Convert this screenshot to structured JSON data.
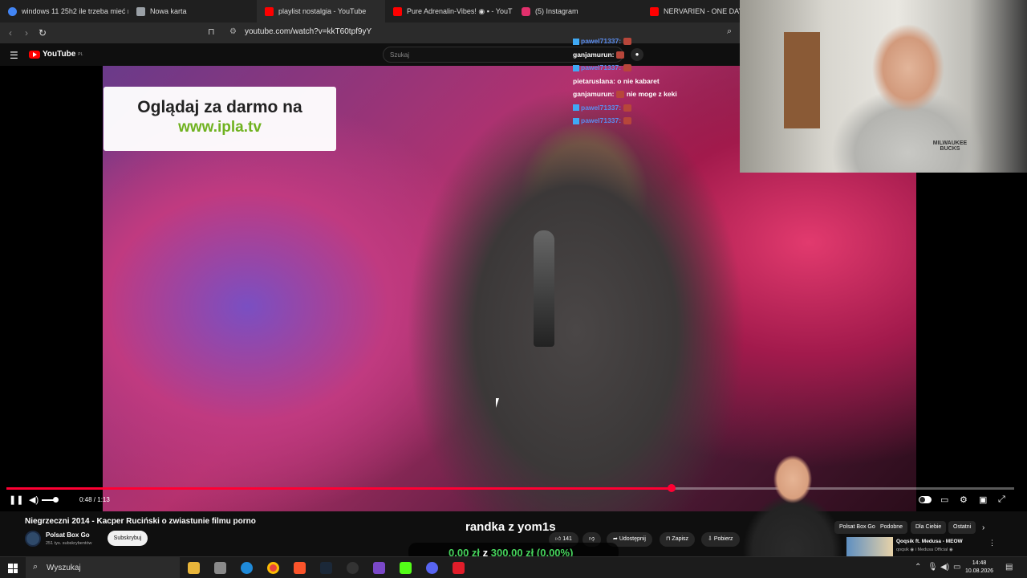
{
  "browser": {
    "tabs": [
      {
        "label": "windows 11 25h2 ile trzeba mieć m",
        "color": "#4285f4"
      },
      {
        "label": "Nowa karta",
        "color": "#9aa0a6"
      },
      {
        "label": "playlist nostalgia - YouTube",
        "color": "#ff0000"
      },
      {
        "label": "Pure Adrenalin-Vibes! ◉ ▪ - YouT",
        "color": "#ff0000"
      },
      {
        "label": "(5) Instagram",
        "color": "#e1306c"
      },
      {
        "label": "NERVARIEN - ONE DAY 12",
        "color": "#ff0000"
      }
    ],
    "url": "youtube.com/watch?v=kkT60tpf9yY"
  },
  "youtube": {
    "logo_text": "YouTube",
    "logo_region": "PL",
    "search_placeholder": "Szukaj",
    "player": {
      "ad_line1": "Oglądaj za darmo na",
      "ad_line2": "www.ipla.tv",
      "time": "0:48 / 1:13",
      "progress": 0.66
    },
    "video": {
      "title": "Niegrzeczni 2014 - Kacper Ruciński o zwiastunie filmu porno",
      "channel": "Polsat Box Go",
      "subscribers": "251 tys. subskrybentów",
      "subscribe_label": "Subskrybuj",
      "likes": "141",
      "share_label": "Udostępnij",
      "save_label": "Zapisz",
      "download_label": "Pobierz"
    },
    "chips": [
      "Polsat Box Go",
      "Podobne",
      "Dla Ciebie",
      "Ostatni"
    ],
    "next_video": {
      "title": "Qoqsik ft. Medusa - MEOW",
      "channel": "qoqsik ◉ i Medusa Official ◉"
    }
  },
  "stream_chat": [
    {
      "user": "pawel71337:",
      "style": "blue"
    },
    {
      "user": "ganjamurun:",
      "style": "white"
    },
    {
      "user": "pawel71337:",
      "style": "blue"
    },
    {
      "user": "pietaruslana:",
      "message": "o nie kabaret",
      "style": "white"
    },
    {
      "user": "ganjamurun:",
      "message": "nie moge z keki",
      "style": "white"
    },
    {
      "user": "pawel71337:",
      "style": "blue"
    },
    {
      "user": "pawel71337:",
      "style": "blue"
    }
  ],
  "stream_overlay": {
    "title": "randka z yom1s",
    "donation_current": "0,00 zł",
    "donation_separator": "z",
    "donation_goal": "300,00 zł",
    "donation_percent": "(0.00%)",
    "webcam_shirt_text": "MILWAUKEE BUCKS"
  },
  "taskbar": {
    "search_label": "Wyszukaj",
    "time": "14:48",
    "date": "10.08.2026"
  }
}
